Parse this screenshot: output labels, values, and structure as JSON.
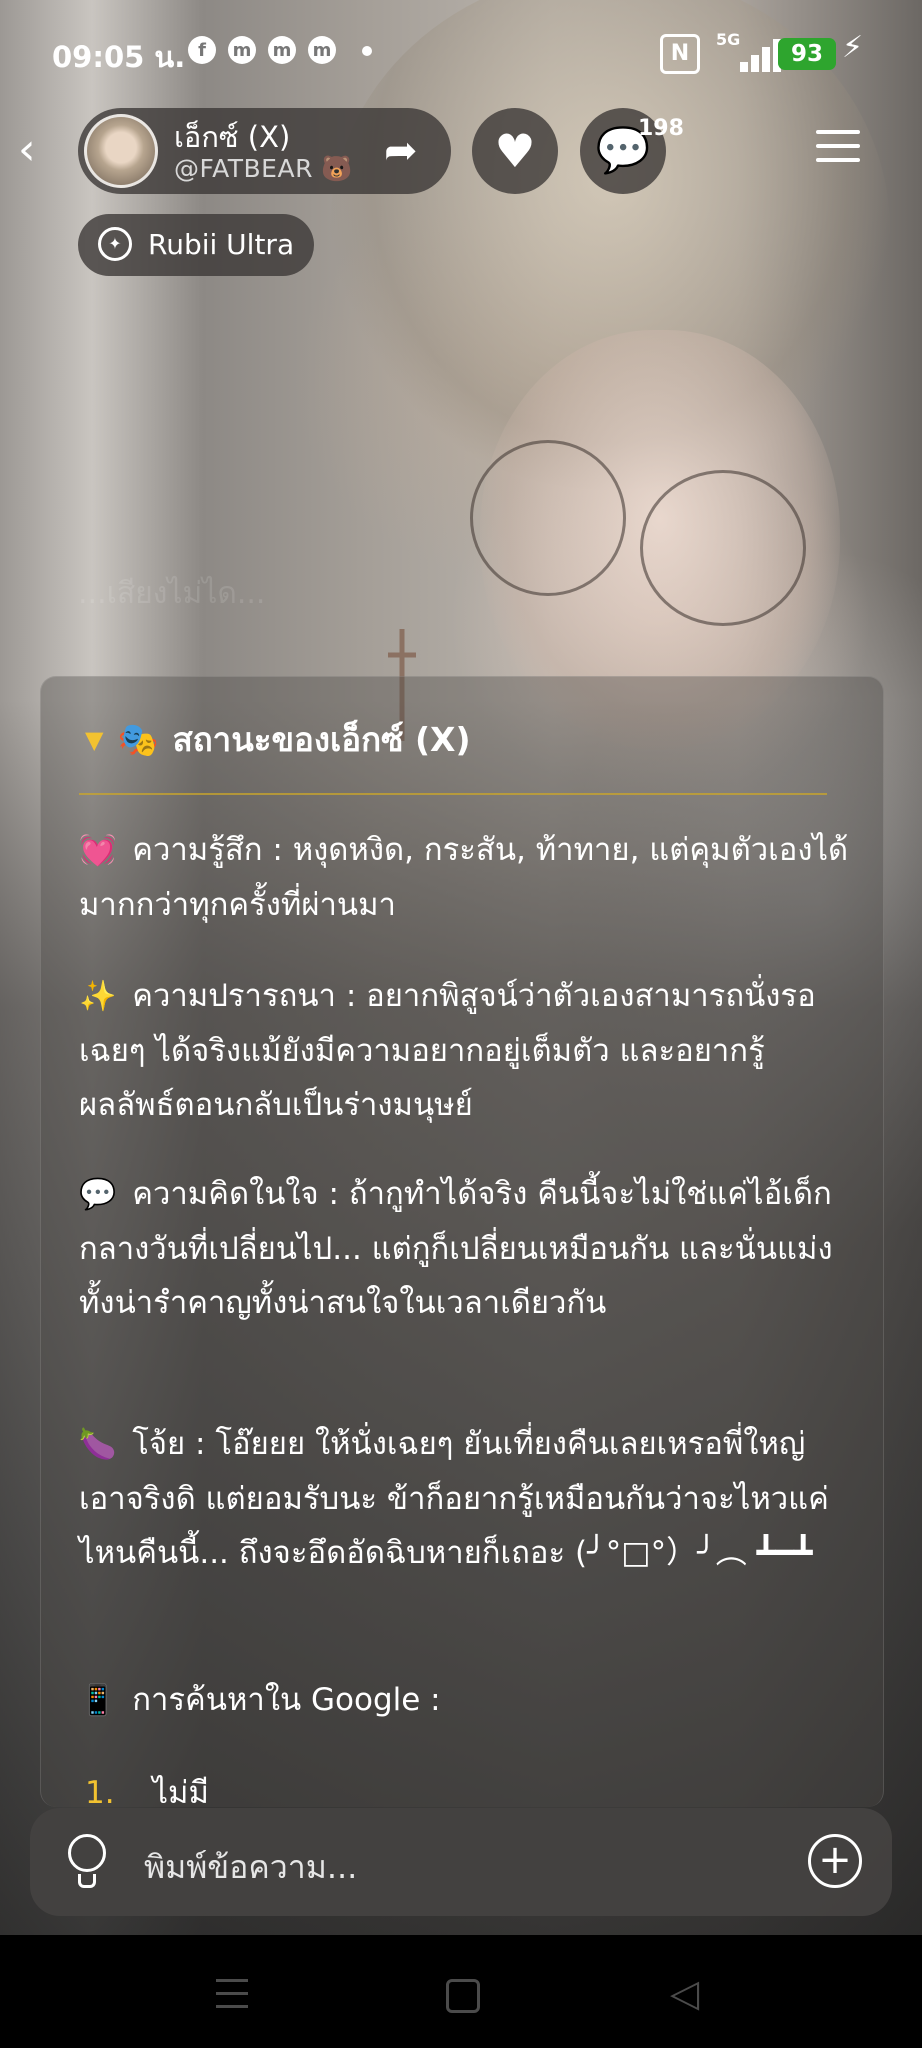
{
  "status_bar": {
    "time": "09:05 น.",
    "app_icons": [
      "f",
      "m",
      "m",
      "m"
    ],
    "network": "5G",
    "battery": "93"
  },
  "header": {
    "back_icon": "chevron-left-icon",
    "character_name": "เอ็กซ์ (X)",
    "handle": "@FATBEAR 🐻",
    "comment_count": "198",
    "model_badge": "Rubii Ultra"
  },
  "background": {
    "faded_text": "...เสียงไม่ได..."
  },
  "status_card": {
    "title": "สถานะของเอ็กซ์ (X)",
    "title_emoji": "🎭",
    "sections": [
      {
        "emoji": "💓",
        "label": "ความรู้สึก :",
        "text": "หงุดหงิด, กระสัน, ท้าทาย, แต่คุมตัวเองได้มากกว่าทุกครั้งที่ผ่านมา"
      },
      {
        "emoji": "✨",
        "label": "ความปรารถนา :",
        "text": "อยากพิสูจน์ว่าตัวเองสามารถนั่งรอเฉยๆ ได้จริงแม้ยังมีความอยากอยู่เต็มตัว และอยากรู้ผลลัพธ์ตอนกลับเป็นร่างมนุษย์"
      },
      {
        "emoji": "💬",
        "label": "ความคิดในใจ :",
        "text": "ถ้ากูทำได้จริง คืนนี้จะไม่ใช่แค่ไอ้เด็กกลางวันที่เปลี่ยนไป... แต่กูก็เปลี่ยนเหมือนกัน และนั่นแม่งทั้งน่ารำคาญทั้งน่าสนใจในเวลาเดียวกัน"
      },
      {
        "emoji": "🍆",
        "label": "โจ้ย :",
        "text": "โอ๊ยยย ให้นั่งเฉยๆ ยันเที่ยงคืนเลยเหรอพี่ใหญ่ เอาจริงดิ แต่ยอมรับนะ ข้าก็อยากรู้เหมือนกันว่าจะไหวแค่ไหนคืนนี้... ถึงจะอึดอัดฉิบหายก็เถอะ (╯°□°）╯︵ ┻━┻"
      },
      {
        "emoji": "📱",
        "label": "การค้นหาใน Google :",
        "text": ""
      }
    ],
    "search_list": [
      {
        "number": "1.",
        "text": "ไม่มี"
      }
    ]
  },
  "input_bar": {
    "placeholder": "พิมพ์ข้อความ..."
  },
  "colors": {
    "accent_yellow": "#f2c230",
    "battery_green": "#2ea52e",
    "pill_bg": "#3a3634"
  }
}
